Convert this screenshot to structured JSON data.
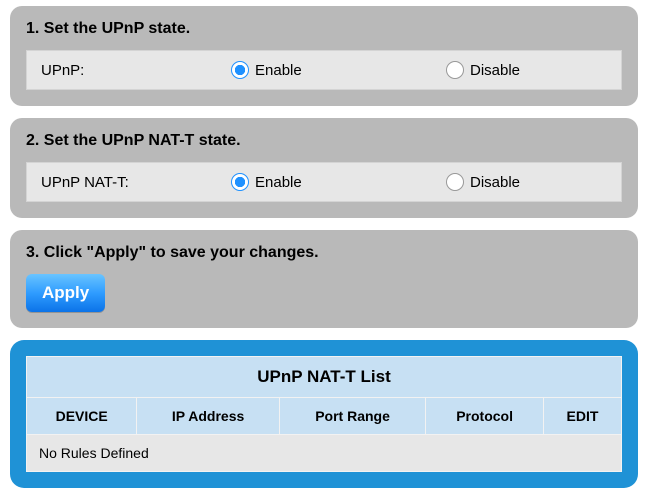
{
  "step1": {
    "title": "1. Set the UPnP state.",
    "label": "UPnP:",
    "enable": "Enable",
    "disable": "Disable"
  },
  "step2": {
    "title": "2. Set the UPnP NAT-T state.",
    "label": "UPnP NAT-T:",
    "enable": "Enable",
    "disable": "Disable"
  },
  "step3": {
    "title": "3. Click \"Apply\" to save your changes.",
    "apply": "Apply"
  },
  "natt": {
    "title": "UPnP NAT-T List",
    "cols": {
      "device": "DEVICE",
      "ip": "IP Address",
      "portrange": "Port Range",
      "protocol": "Protocol",
      "edit": "EDIT"
    },
    "empty": "No Rules Defined"
  }
}
